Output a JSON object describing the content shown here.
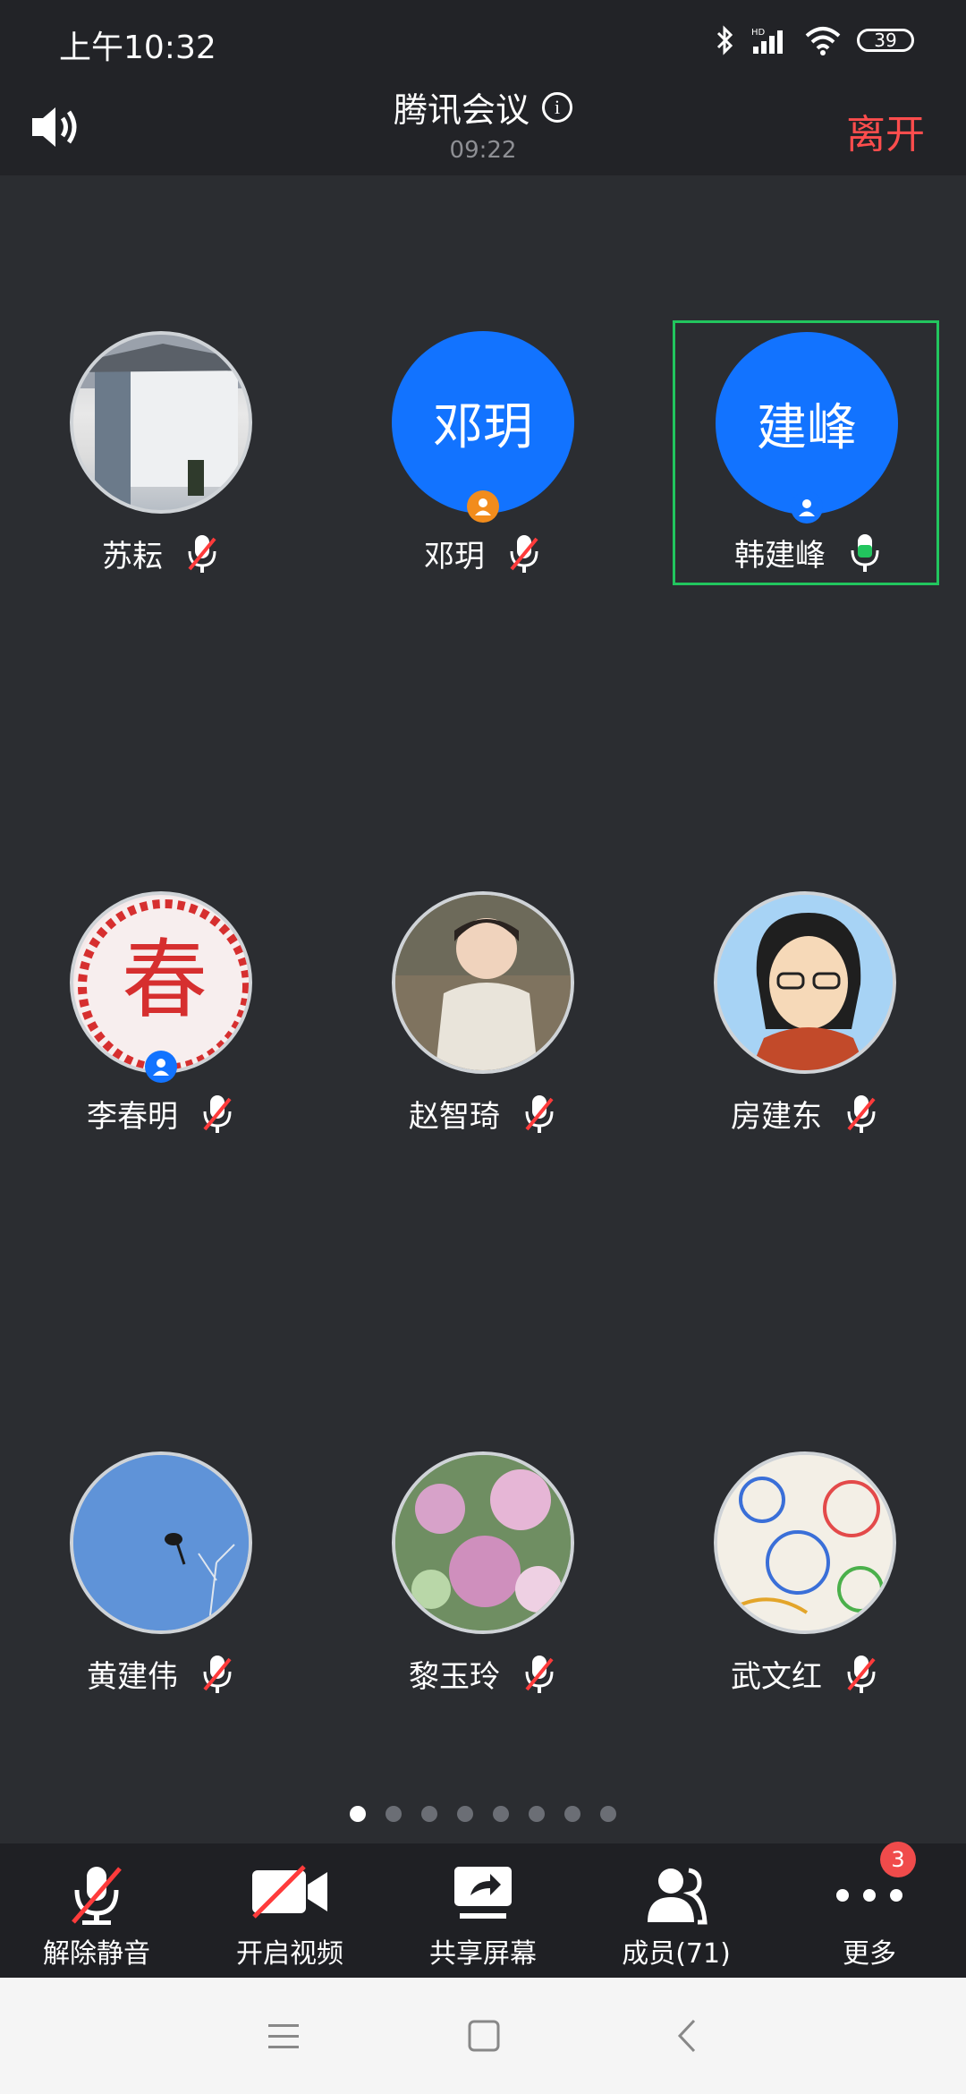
{
  "status_bar": {
    "time": "上午10:32",
    "battery": "39",
    "network_label": "HD"
  },
  "header": {
    "title": "腾讯会议",
    "timer": "09:22",
    "leave_label": "离开"
  },
  "participants": [
    {
      "name": "苏耘",
      "avatar": "photo",
      "mic": "muted"
    },
    {
      "name": "邓玥",
      "avatar_text": "邓玥",
      "mic": "muted",
      "badge": "host"
    },
    {
      "name": "韩建峰",
      "avatar_text": "建峰",
      "mic": "active",
      "badge": "cohost",
      "highlighted": true
    },
    {
      "name": "李春明",
      "avatar": "photo",
      "mic": "muted",
      "badge": "cohost"
    },
    {
      "name": "赵智琦",
      "avatar": "photo",
      "mic": "muted"
    },
    {
      "name": "房建东",
      "avatar": "photo",
      "mic": "muted"
    },
    {
      "name": "黄建伟",
      "avatar": "photo",
      "mic": "muted"
    },
    {
      "name": "黎玉玲",
      "avatar": "photo",
      "mic": "muted"
    },
    {
      "name": "武文红",
      "avatar": "photo",
      "mic": "muted"
    }
  ],
  "pager": {
    "count": 8,
    "current": 1
  },
  "toolbar": {
    "unmute": "解除静音",
    "start_video": "开启视频",
    "share_screen": "共享屏幕",
    "members": "成员(71)",
    "more": "更多",
    "more_badge": "3"
  },
  "colors": {
    "accent": "#1273ff",
    "leave": "#ff4d4d",
    "active_border": "#22c55e",
    "mute_red": "#ff3b3b"
  }
}
